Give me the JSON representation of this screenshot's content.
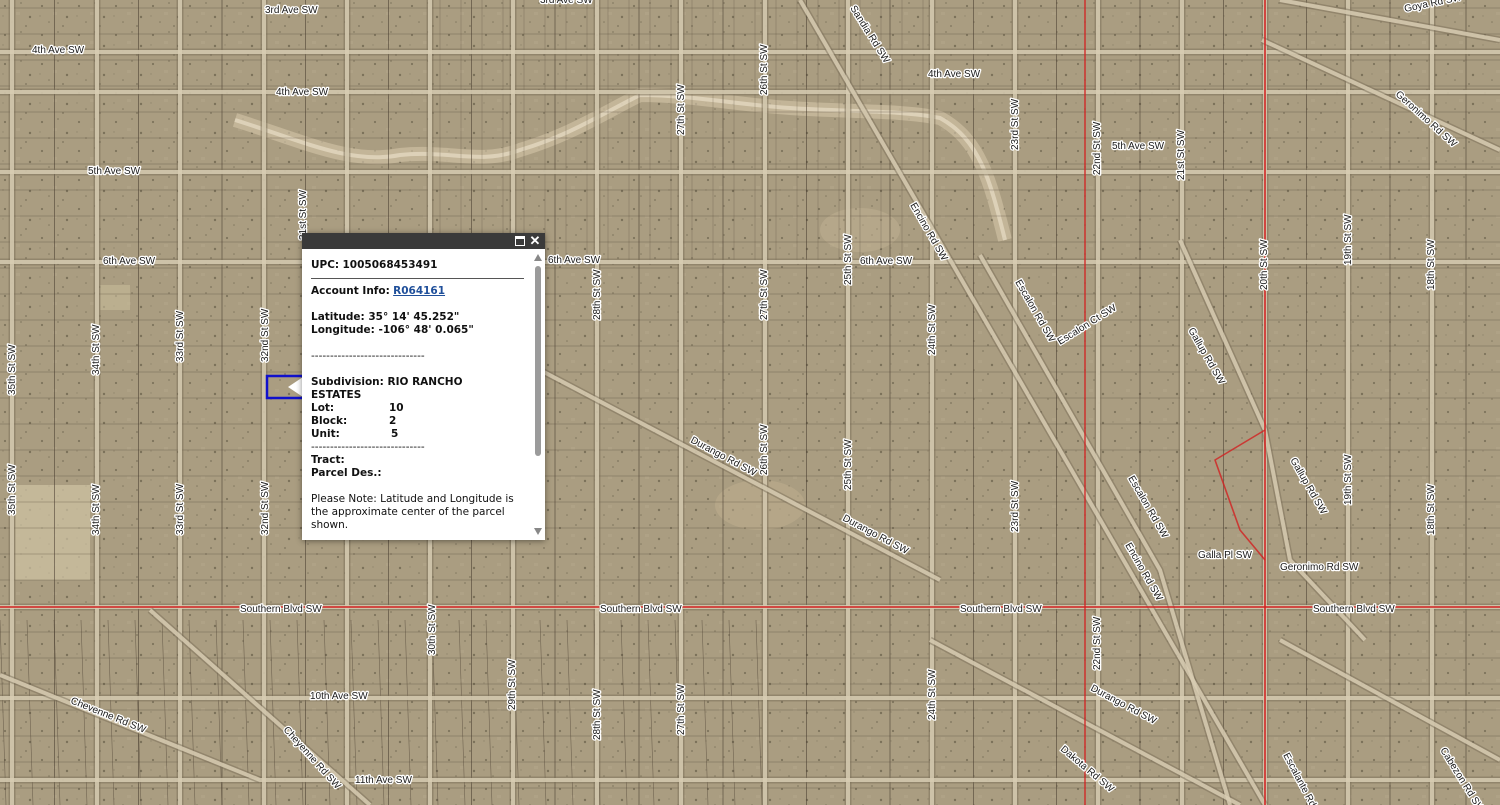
{
  "map": {
    "roads": [
      {
        "name": "3rd Ave SW"
      },
      {
        "name": "4th Ave SW"
      },
      {
        "name": "5th Ave SW"
      },
      {
        "name": "6th Ave SW"
      },
      {
        "name": "10th Ave SW"
      },
      {
        "name": "11th Ave SW"
      },
      {
        "name": "Southern Blvd SW"
      },
      {
        "name": "Durango Rd SW"
      },
      {
        "name": "Encino Rd SW"
      },
      {
        "name": "Escalon Rd SW"
      },
      {
        "name": "Escalon Ct SW"
      },
      {
        "name": "Gallup Rd SW"
      },
      {
        "name": "Goya Rd SW"
      },
      {
        "name": "Geronimo Rd SW"
      },
      {
        "name": "Galla Pl SW"
      },
      {
        "name": "Chevenne Rd SW"
      },
      {
        "name": "Cheyenne Rd SW"
      },
      {
        "name": "Dakota Rd SW"
      },
      {
        "name": "Escalante Rd SW"
      },
      {
        "name": "Cabezon Rd SW"
      },
      {
        "name": "Sandia Rd SW"
      },
      {
        "name": "35th St SW"
      },
      {
        "name": "34th St SW"
      },
      {
        "name": "33rd St SW"
      },
      {
        "name": "32nd St SW"
      },
      {
        "name": "31st St SW"
      },
      {
        "name": "30th St SW"
      },
      {
        "name": "29th St SW"
      },
      {
        "name": "28th St SW"
      },
      {
        "name": "27th St SW"
      },
      {
        "name": "26th St SW"
      },
      {
        "name": "25th St SW"
      },
      {
        "name": "24th St SW"
      },
      {
        "name": "23rd St SW"
      },
      {
        "name": "22nd St SW"
      },
      {
        "name": "21st St SW"
      },
      {
        "name": "20th St SW"
      },
      {
        "name": "19th St SW"
      },
      {
        "name": "18th St SW"
      }
    ],
    "colors": {
      "ground": "#a89c82",
      "road": "#d8cdb3",
      "parcel_line": "#4a3e30",
      "boundary": "#d22020",
      "selected_parcel": "#1010cc"
    }
  },
  "popup": {
    "upc_label": "UPC:",
    "upc_value": "1005068453491",
    "account_label": "Account Info:",
    "account_value": "R064161",
    "latitude": "Latitude: 35° 14' 45.252\"",
    "longitude": "Longitude: -106° 48' 0.065\"",
    "separator": "------------------------------",
    "subdivision_line1": "Subdivision: RIO RANCHO",
    "subdivision_line2": "ESTATES",
    "lot_label": "Lot:",
    "lot_value": "10",
    "block_label": "Block:",
    "block_value": "2",
    "unit_label": "Unit:",
    "unit_value": "5",
    "separator2": "------------------------------",
    "tract_label": "Tract:",
    "parcel_label": "Parcel Des.:",
    "note": "Please Note: Latitude and Longitude is the approximate center of the parcel shown.",
    "icons": {
      "maximize": "maximize-icon",
      "close": "close-icon"
    }
  }
}
